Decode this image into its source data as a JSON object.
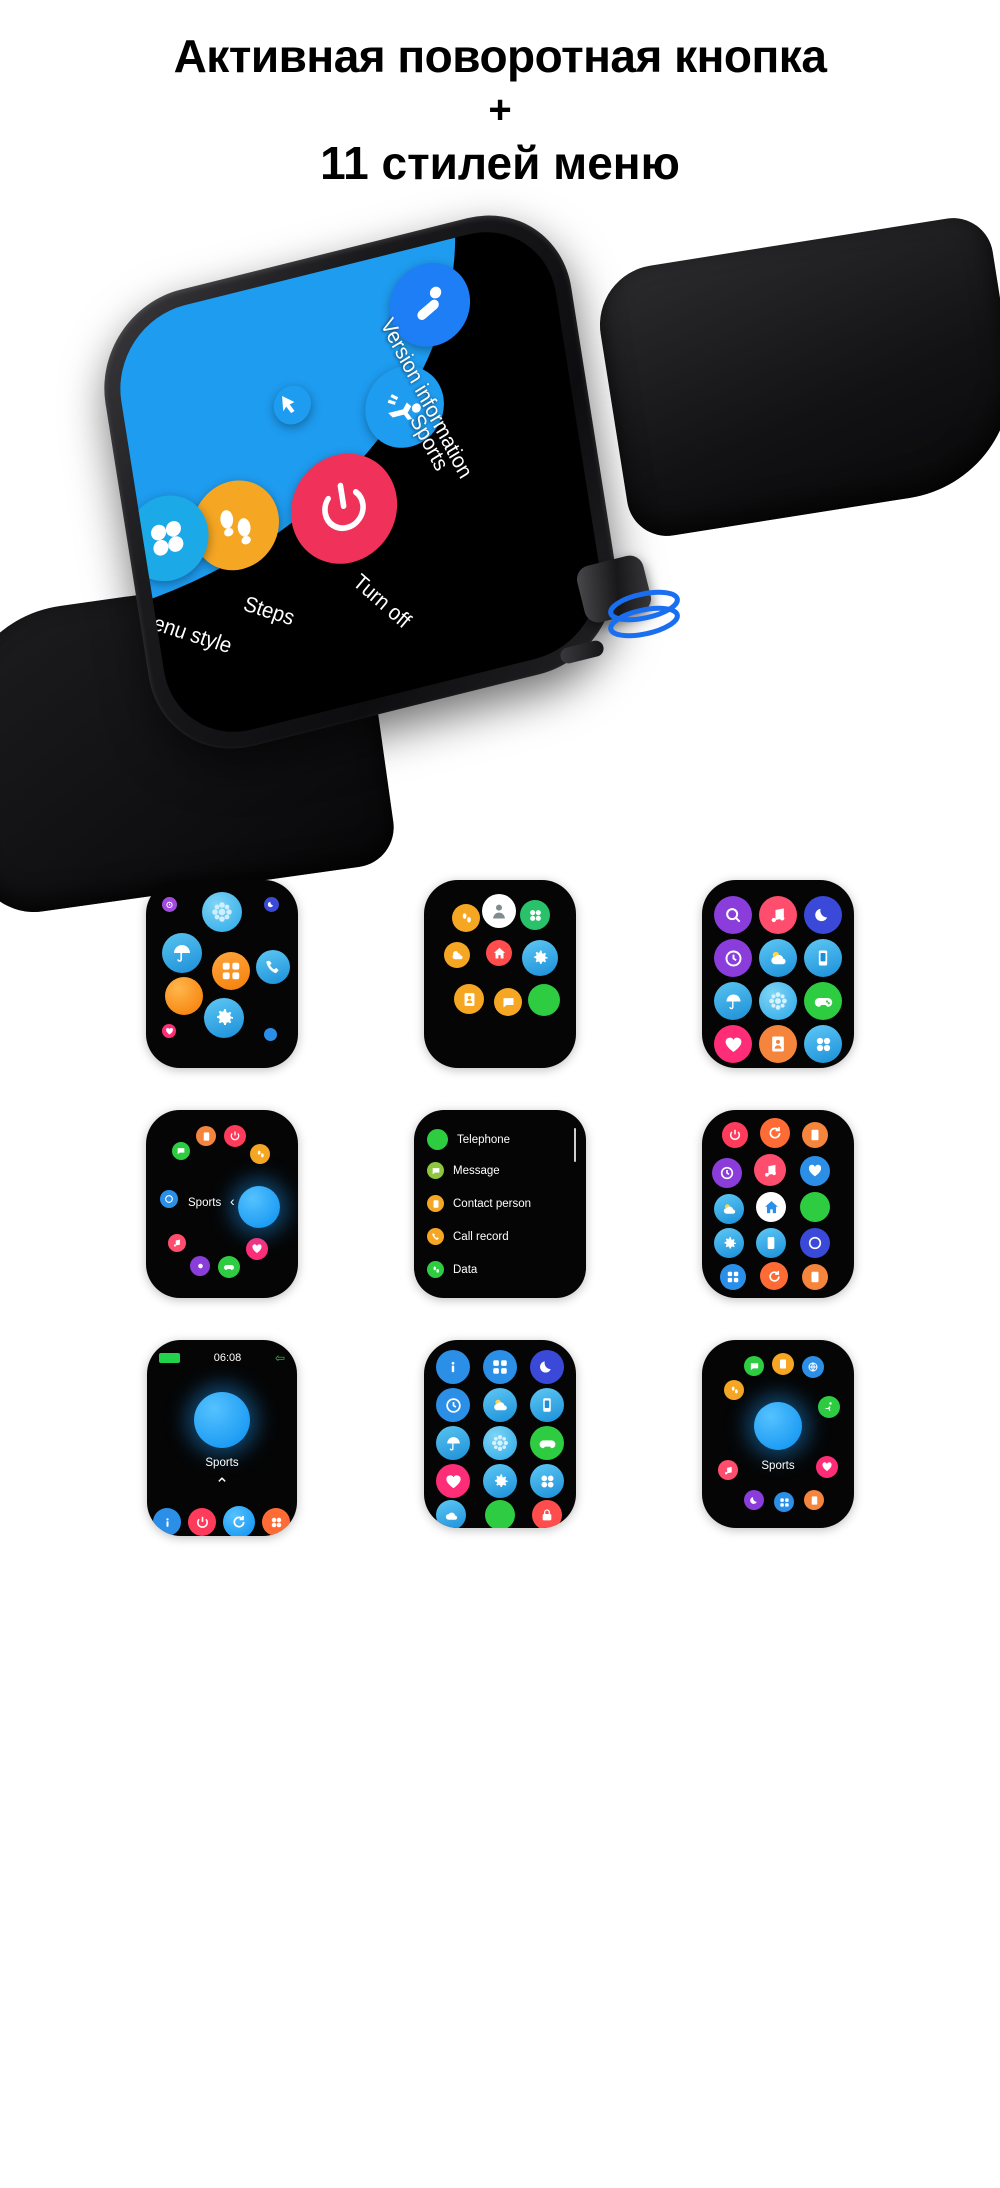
{
  "header": {
    "line1": "Активная поворотная кнопка",
    "plus": "+",
    "line2": "11 стилей меню"
  },
  "hero": {
    "labels": {
      "version_information": "Version information",
      "sports": "Sports",
      "turn_off": "Turn off",
      "steps": "Steps",
      "menu_style": "Menu style"
    },
    "icons": [
      {
        "name": "person-walk-icon",
        "color": "#1d7ef5"
      },
      {
        "name": "runner-icon",
        "color": "#1e9cf0"
      },
      {
        "name": "power-off-icon",
        "color": "#f0325b"
      },
      {
        "name": "footsteps-icon",
        "color": "#f5a623"
      },
      {
        "name": "fan-icon",
        "color": "#1ba9e8"
      },
      {
        "name": "cursor-arrow-icon",
        "color": "#1e9cf0"
      }
    ],
    "rotary_highlight_color": "#1a6ef0"
  },
  "menu_styles": [
    {
      "id": 1,
      "name": "grid-scatter-style",
      "icons": [
        "alarm-icon",
        "snowflake-icon",
        "moon-icon",
        "umbrella-icon",
        "flower-icon",
        "gamepad-icon",
        "orange-blank-icon",
        "apps-icon",
        "phone-icon",
        "heart-rate-icon",
        "gear-icon",
        "dots-icon"
      ]
    },
    {
      "id": 2,
      "name": "cluster-bubble-style",
      "icons": [
        "footsteps-icon",
        "person-icon",
        "fan-icon",
        "weather-icon",
        "home-icon",
        "gear-icon",
        "contact-icon",
        "message-icon",
        "green-blank-icon"
      ]
    },
    {
      "id": 3,
      "name": "rounded-grid-style",
      "icons": [
        "search-icon",
        "music-icon",
        "moon-icon",
        "clock-icon",
        "weather-icon",
        "phone-sync-icon",
        "umbrella-icon",
        "snowflake-icon",
        "gamepad-icon",
        "heart-rate-icon",
        "contact-icon",
        "fan-icon"
      ]
    },
    {
      "id": 4,
      "name": "circular-dial-style",
      "label": "Sports",
      "chevron": "‹",
      "icons": [
        "contact-icon",
        "power-icon",
        "footsteps-icon",
        "message-icon",
        "music-icon",
        "heart-icon",
        "gamepad-icon",
        "weather-icon",
        "clock-icon"
      ]
    },
    {
      "id": 5,
      "name": "vertical-list-style",
      "items": [
        {
          "label": "Telephone",
          "icon": "phone-icon",
          "color": "#2ecc40"
        },
        {
          "label": "Message",
          "icon": "message-icon",
          "color": "#8ec63f"
        },
        {
          "label": "Contact person",
          "icon": "contact-icon",
          "color": "#f5a623"
        },
        {
          "label": "Call record",
          "icon": "call-record-icon",
          "color": "#f5a623"
        },
        {
          "label": "Data",
          "icon": "footsteps-icon",
          "color": "#2ecc40"
        }
      ]
    },
    {
      "id": 6,
      "name": "dense-grid-style",
      "icons": [
        "power-icon",
        "refresh-icon",
        "contact-icon",
        "clock-icon",
        "music-icon",
        "heart-rate-icon",
        "weather-icon",
        "home-icon",
        "green-blank-icon",
        "gear-icon",
        "phone-sync-icon",
        "clock-icon",
        "apps-icon",
        "refresh-icon",
        "contact-icon"
      ]
    },
    {
      "id": 7,
      "name": "single-focus-style",
      "time": "06:08",
      "label": "Sports",
      "chevron": "⌃",
      "dock": [
        "info-icon",
        "power-icon",
        "refresh-icon",
        "fan-icon"
      ]
    },
    {
      "id": 8,
      "name": "grid-list-style",
      "icons": [
        "info-icon",
        "apps-icon",
        "moon-icon",
        "clock-icon",
        "weather-icon",
        "phone-sync-icon",
        "umbrella-icon",
        "snowflake-icon",
        "gamepad-icon",
        "heart-rate-icon",
        "gear-icon",
        "fan-icon",
        "weather-icon",
        "green-blank-icon",
        "lock-icon"
      ]
    },
    {
      "id": 9,
      "name": "orbit-focus-style",
      "label": "Sports",
      "icons": [
        "message-icon",
        "contact-icon",
        "globe-icon",
        "footsteps-icon",
        "runner-icon",
        "music-icon",
        "heart-rate-icon",
        "moon-icon",
        "apps-icon",
        "contact-icon"
      ]
    }
  ]
}
